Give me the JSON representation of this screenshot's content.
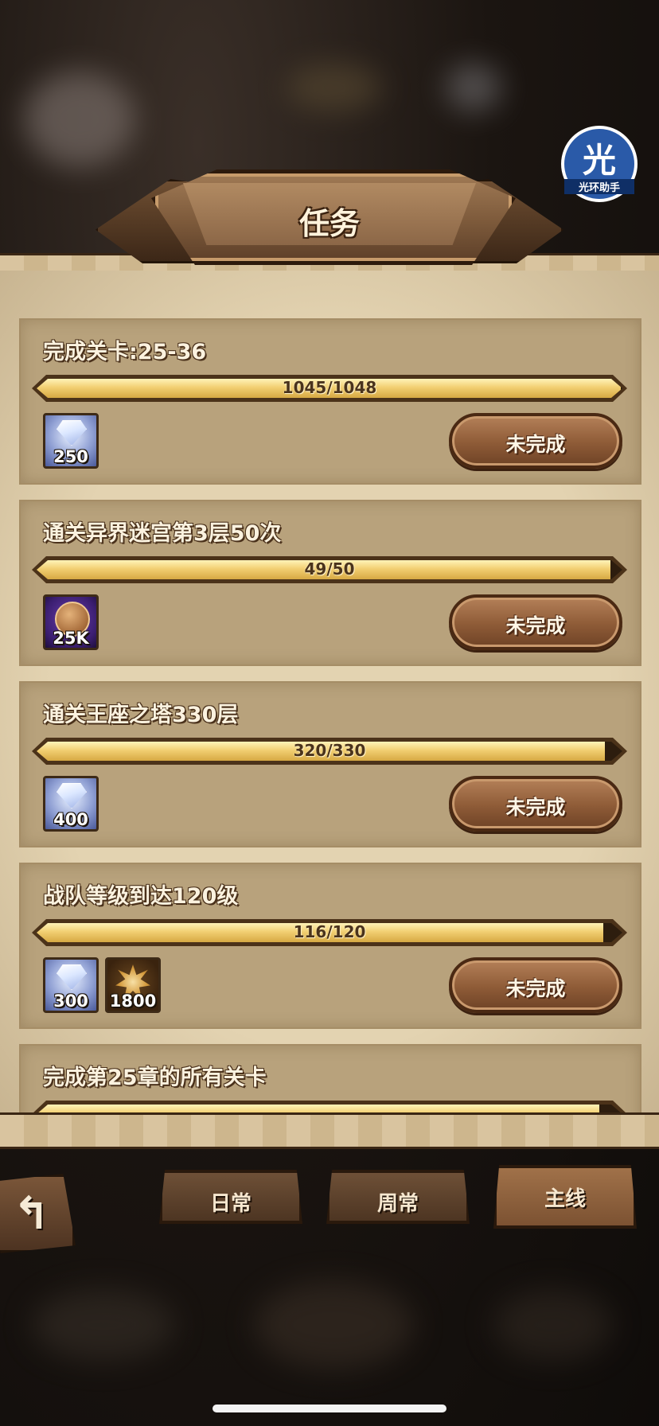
{
  "header": {
    "title": "任务"
  },
  "watermark": {
    "glyph": "光",
    "label": "光环助手"
  },
  "tasks": [
    {
      "title": "完成关卡:25-36",
      "progress_text": "1045/1048",
      "progress_fraction": 0.997,
      "rewards": [
        {
          "icon": "diamond-icon",
          "count": "250"
        }
      ],
      "status": "未完成"
    },
    {
      "title": "通关异界迷宫第3层50次",
      "progress_text": "49/50",
      "progress_fraction": 0.98,
      "rewards": [
        {
          "icon": "labyrinth-coin-icon",
          "count": "25K"
        }
      ],
      "status": "未完成"
    },
    {
      "title": "通关王座之塔330层",
      "progress_text": "320/330",
      "progress_fraction": 0.97,
      "rewards": [
        {
          "icon": "diamond-icon",
          "count": "400"
        }
      ],
      "status": "未完成"
    },
    {
      "title": "战队等级到达120级",
      "progress_text": "116/120",
      "progress_fraction": 0.967,
      "rewards": [
        {
          "icon": "diamond-icon",
          "count": "300"
        },
        {
          "icon": "hero-emblem-icon",
          "count": "1800"
        }
      ],
      "status": "未完成"
    },
    {
      "title": "完成第25章的所有关卡",
      "progress_fraction": 0.96
    }
  ],
  "tabs": [
    {
      "label": "日常",
      "active": false
    },
    {
      "label": "周常",
      "active": false
    },
    {
      "label": "主线",
      "active": true
    }
  ],
  "colors": {
    "panel": "#e3d3b1",
    "card": "#b8a27c",
    "progress_fill": "#f2cf72",
    "button": "#8e5b37"
  }
}
